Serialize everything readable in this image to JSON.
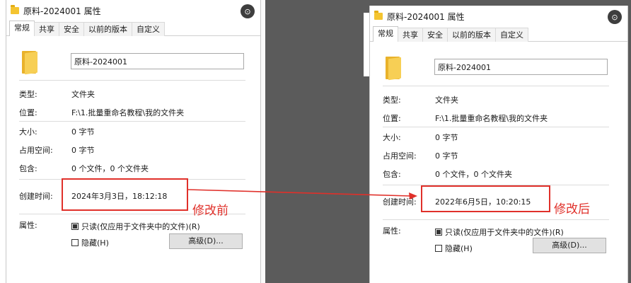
{
  "left_dialog": {
    "title": "原料-2024001 属性",
    "tabs": [
      "常规",
      "共享",
      "安全",
      "以前的版本",
      "自定义"
    ],
    "name_value": "原料-2024001",
    "rows": {
      "type_label": "类型:",
      "type_value": "文件夹",
      "location_label": "位置:",
      "location_value": "F:\\1.批量重命名教程\\我的文件夹",
      "size_label": "大小:",
      "size_value": "0 字节",
      "disk_label": "占用空间:",
      "disk_value": "0 字节",
      "contains_label": "包含:",
      "contains_value": "0 个文件，0 个文件夹",
      "created_label": "创建时间:",
      "created_value": "2024年3月3日，18:12:18",
      "attrs_label": "属性:"
    },
    "readonly_label": "只读(仅应用于文件夹中的文件)(R)",
    "hidden_label": "隐藏(H)",
    "advanced_label": "高级(D)..."
  },
  "right_dialog": {
    "title": "原料-2024001 属性",
    "tabs": [
      "常规",
      "共享",
      "安全",
      "以前的版本",
      "自定义"
    ],
    "name_value": "原料-2024001",
    "rows": {
      "type_label": "类型:",
      "type_value": "文件夹",
      "location_label": "位置:",
      "location_value": "F:\\1.批量重命名教程\\我的文件夹",
      "size_label": "大小:",
      "size_value": "0 字节",
      "disk_label": "占用空间:",
      "disk_value": "0 字节",
      "contains_label": "包含:",
      "contains_value": "0 个文件，0 个文件夹",
      "created_label": "创建时间:",
      "created_value": "2022年6月5日，10:20:15",
      "attrs_label": "属性:"
    },
    "readonly_label": "只读(仅应用于文件夹中的文件)(R)",
    "hidden_label": "隐藏(H)",
    "advanced_label": "高级(D)..."
  },
  "annotations": {
    "before": "修改前",
    "after": "修改后"
  },
  "colors": {
    "annotation_red": "#e0302a",
    "folder_yellow": "#f4c430"
  },
  "icons": {
    "title": "folder-icon",
    "lens": "lens-icon"
  }
}
